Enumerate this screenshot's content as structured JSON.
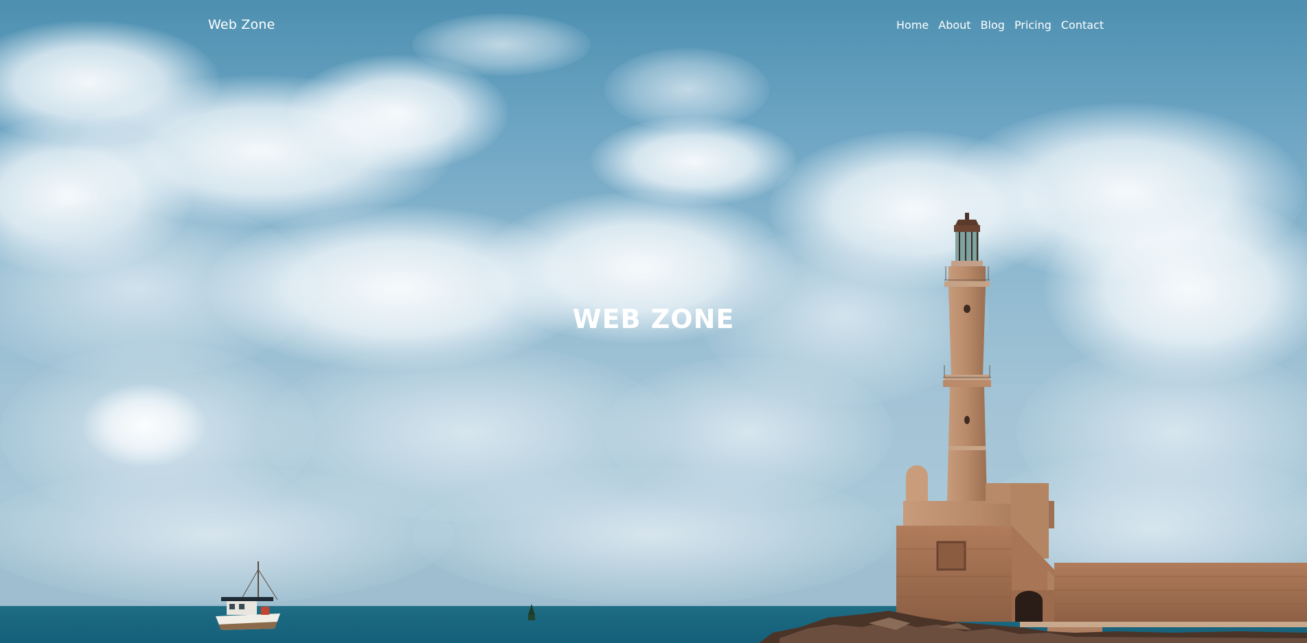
{
  "nav": {
    "brand": "Web Zone",
    "items": [
      {
        "label": "Home"
      },
      {
        "label": "About"
      },
      {
        "label": "Blog"
      },
      {
        "label": "Pricing"
      },
      {
        "label": "Contact"
      }
    ]
  },
  "hero": {
    "title": "WEB ZONE",
    "background_image": "lighthouse-harbor-photo"
  },
  "colors": {
    "sky": "#6aa3c2",
    "sea": "#1a6780",
    "stone": "#b98a6a",
    "text": "#ffffff"
  }
}
